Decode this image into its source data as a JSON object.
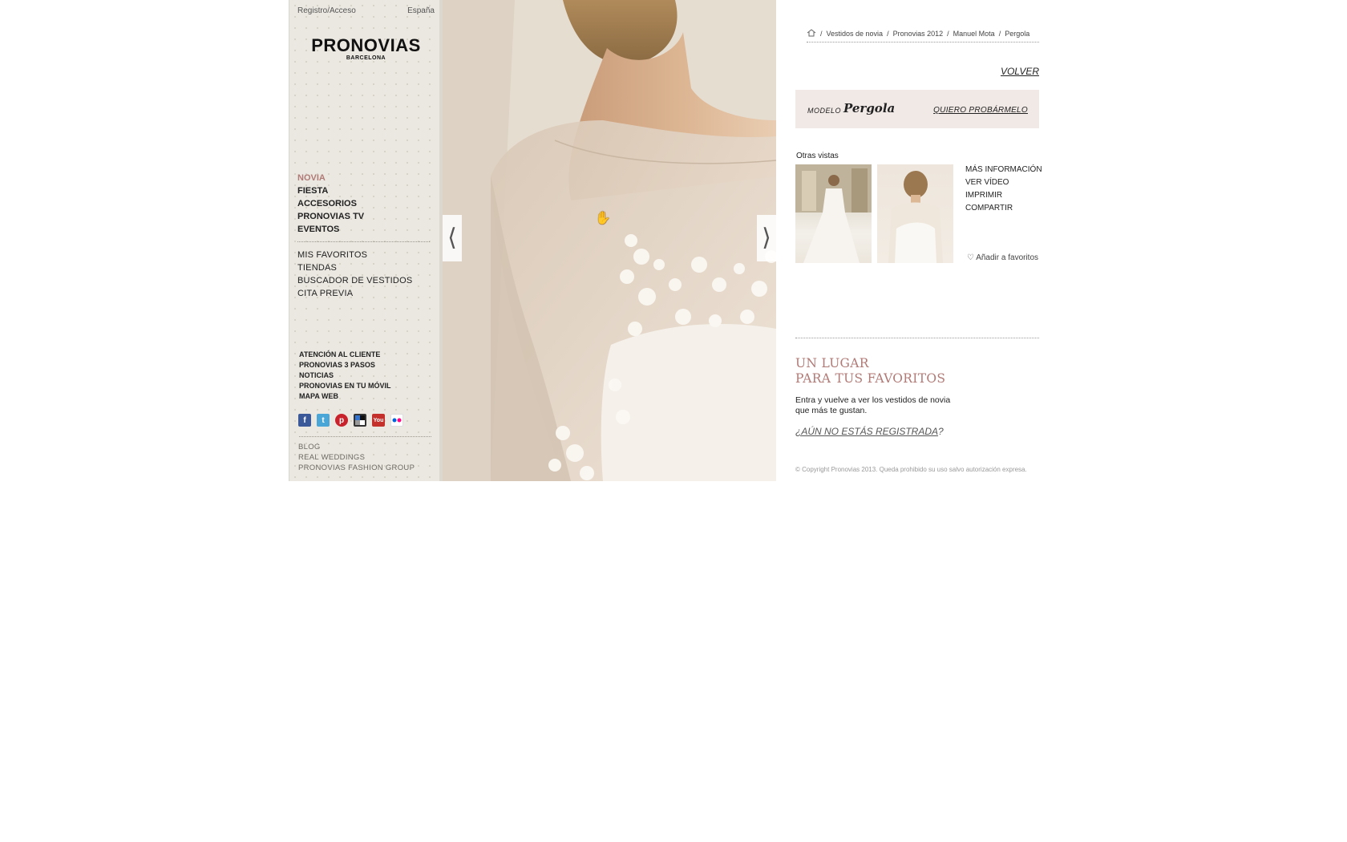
{
  "sidebar": {
    "login_label": "Registro/Acceso",
    "country_label": "España",
    "logo_name": "PRONOVIAS",
    "logo_sub": "BARCELONA",
    "main_nav": [
      "NOVIA",
      "FIESTA",
      "ACCESORIOS",
      "PRONOVIAS TV",
      "EVENTOS"
    ],
    "secondary_nav": [
      "MIS FAVORITOS",
      "TIENDAS",
      "BUSCADOR DE VESTIDOS",
      "CITA PREVIA"
    ],
    "footer_nav": [
      "ATENCIÓN AL CLIENTE",
      "PRONOVIAS 3 PASOS",
      "NOTICIAS",
      "PRONOVIAS EN TU MÓVIL",
      "MAPA WEB"
    ],
    "social_icons": [
      "facebook-icon",
      "twitter-icon",
      "pinterest-icon",
      "delicious-icon",
      "youtube-icon",
      "flickr-icon"
    ],
    "bottom_links": [
      "BLOG",
      "REAL WEDDINGS",
      "PRONOVIAS FASHION GROUP"
    ]
  },
  "viewer": {
    "prev_icon": "chevron-left-icon",
    "next_icon": "chevron-right-icon",
    "close_icon": "close-icon",
    "cursor_icon": "hand-grab-icon",
    "favorite_icon": "heart-plus-icon"
  },
  "detail": {
    "breadcrumb": [
      "/",
      "Vestidos de novia",
      "/",
      "Pronovias 2012",
      "/",
      "Manuel Mota",
      "/",
      "Pergola"
    ],
    "back_label": "VOLVER",
    "model_label": "MODELO",
    "model_name": "Pergola",
    "try_label": "QUIERO PROBÁRMELO",
    "other_views_label": "Otras vistas",
    "links": [
      "MÁS INFORMACIÓN",
      "VER VÍDEO",
      "IMPRIMIR",
      "COMPARTIR"
    ],
    "add_favorite_label": "Añadir a favoritos"
  },
  "promo": {
    "title_line1": "UN LUGAR",
    "title_line2": "PARA TUS FAVORITOS",
    "text": "Entra y vuelve a ver los vestidos de novia que más te gustan.",
    "register_link": "¿AÚN NO ESTÁS REGISTRADA",
    "register_suffix": "?",
    "copyright": "© Copyright Pronovias 2013. Queda prohibido su uso salvo autorización expresa."
  },
  "colors": {
    "accent": "#b07a76",
    "sidebar_bg": "#ebe8e1",
    "model_box_bg": "#f1e9e6"
  }
}
